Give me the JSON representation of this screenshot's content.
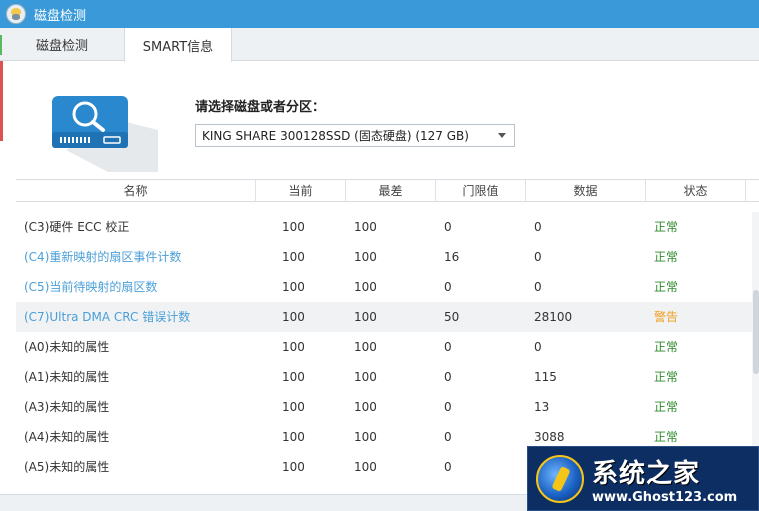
{
  "window": {
    "title": "磁盘检测"
  },
  "tabs": [
    {
      "label": "磁盘检测"
    },
    {
      "label": "SMART信息"
    }
  ],
  "disk_select": {
    "label": "请选择磁盘或者分区：",
    "value": "KING SHARE 300128SSD (固态硬盘)  (127 GB)"
  },
  "table": {
    "headers": [
      "名称",
      "当前",
      "最差",
      "门限值",
      "数据",
      "状态"
    ],
    "rows": [
      {
        "name": "(C3)硬件 ECC 校正",
        "current": "100",
        "worst": "100",
        "threshold": "0",
        "data": "0",
        "status": "正常",
        "name_style": "normal",
        "status_style": "ok"
      },
      {
        "name": "(C4)重新映射的扇区事件计数",
        "current": "100",
        "worst": "100",
        "threshold": "16",
        "data": "0",
        "status": "正常",
        "name_style": "blue",
        "status_style": "ok"
      },
      {
        "name": "(C5)当前待映射的扇区数",
        "current": "100",
        "worst": "100",
        "threshold": "0",
        "data": "0",
        "status": "正常",
        "name_style": "blue",
        "status_style": "ok"
      },
      {
        "name": "(C7)Ultra DMA CRC 错误计数",
        "current": "100",
        "worst": "100",
        "threshold": "50",
        "data": "28100",
        "status": "警告",
        "name_style": "blue",
        "status_style": "warn"
      },
      {
        "name": "(A0)未知的属性",
        "current": "100",
        "worst": "100",
        "threshold": "0",
        "data": "0",
        "status": "正常",
        "name_style": "normal",
        "status_style": "ok"
      },
      {
        "name": "(A1)未知的属性",
        "current": "100",
        "worst": "100",
        "threshold": "0",
        "data": "115",
        "status": "正常",
        "name_style": "normal",
        "status_style": "ok"
      },
      {
        "name": "(A3)未知的属性",
        "current": "100",
        "worst": "100",
        "threshold": "0",
        "data": "13",
        "status": "正常",
        "name_style": "normal",
        "status_style": "ok"
      },
      {
        "name": "(A4)未知的属性",
        "current": "100",
        "worst": "100",
        "threshold": "0",
        "data": "3088",
        "status": "正常",
        "name_style": "normal",
        "status_style": "ok"
      },
      {
        "name": "(A5)未知的属性",
        "current": "100",
        "worst": "100",
        "threshold": "0",
        "data": "",
        "status": "",
        "name_style": "normal",
        "status_style": "ok"
      }
    ]
  },
  "watermark": {
    "title": "系统之家",
    "url": "www.Ghost123.com"
  },
  "colors": {
    "titlebar": "#3a9ad9",
    "ok": "#2e8b2e",
    "warn": "#f0a020",
    "link": "#4a9fd8"
  }
}
